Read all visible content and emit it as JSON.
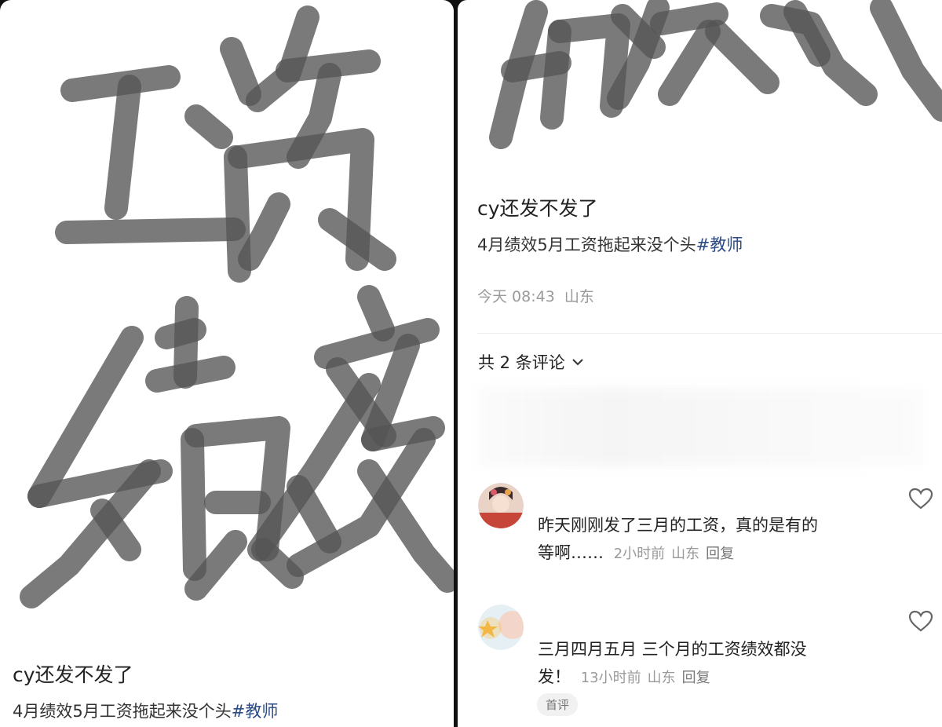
{
  "left_panel": {
    "handwriting_text": "工资绩效",
    "title": "cy还发不发了",
    "body_text": "4月绩效5月工资拖起来没个头",
    "hashtag": "#教师"
  },
  "right_panel": {
    "handwriting_text": "绩效",
    "title": "cy还发不发了",
    "body_text": "4月绩效5月工资拖起来没个头",
    "hashtag": "#教师",
    "time": "今天 08:43",
    "location": "山东",
    "comments_header": "共 2 条评论",
    "comments": [
      {
        "line1": "昨天刚刚发了三月的工资，真的是有的",
        "line2": "等啊……",
        "time": "2小时前",
        "location": "山东",
        "reply_label": "回复"
      },
      {
        "line1": "三月四月五月  三个月的工资绩效都没",
        "line2": "发！",
        "time": "13小时前",
        "location": "山东",
        "reply_label": "回复",
        "badge": "首评"
      }
    ]
  },
  "icons": {
    "heart": "heart-outline-icon",
    "chevron": "chevron-down-icon"
  },
  "colors": {
    "hashtag": "#2b4b84",
    "meta_gray": "#9a9a9a",
    "ink": "#555555"
  }
}
